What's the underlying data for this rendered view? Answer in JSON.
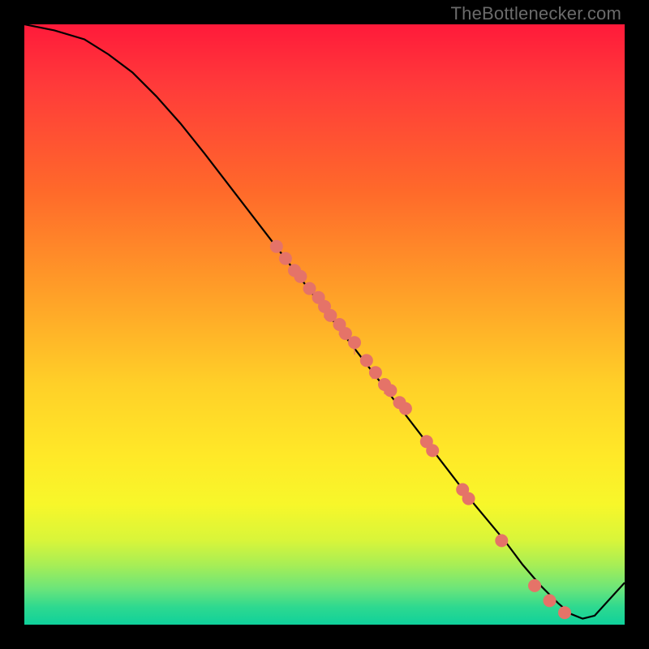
{
  "watermark": "TheBottlenecker.com",
  "chart_data": {
    "type": "line",
    "title": "",
    "xlabel": "",
    "ylabel": "",
    "xlim": [
      0,
      100
    ],
    "ylim": [
      0,
      100
    ],
    "grid": false,
    "series": [
      {
        "name": "curve",
        "x": [
          0,
          5,
          10,
          14,
          18,
          22,
          26,
          30,
          35,
          40,
          45,
          50,
          55,
          60,
          65,
          70,
          75,
          80,
          83,
          86,
          89,
          91,
          93,
          95,
          100
        ],
        "values": [
          100,
          99,
          97.5,
          95,
          92,
          88,
          83.5,
          78.5,
          72,
          65.5,
          59,
          52.5,
          46,
          39.5,
          33,
          26.5,
          20,
          14,
          10,
          6.5,
          3.5,
          1.8,
          1.0,
          1.5,
          7
        ]
      }
    ],
    "markers": {
      "name": "data-points",
      "x": [
        42,
        43.5,
        45,
        46,
        47.5,
        49,
        50,
        51,
        52.5,
        53.5,
        55,
        57,
        58.5,
        60,
        61,
        62.5,
        63.5,
        67,
        68,
        73,
        74,
        79.5,
        85,
        87.5,
        90
      ],
      "values": [
        63,
        61,
        59,
        58,
        56,
        54.5,
        53,
        51.5,
        50,
        48.5,
        47,
        44,
        42,
        40,
        39,
        37,
        36,
        30.5,
        29,
        22.5,
        21,
        14,
        6.5,
        4,
        2
      ]
    },
    "marker_ticks": {
      "x": [
        50,
        52.5,
        55,
        56.5,
        58,
        60
      ],
      "len": [
        8,
        7,
        9,
        6,
        7,
        6
      ]
    }
  }
}
